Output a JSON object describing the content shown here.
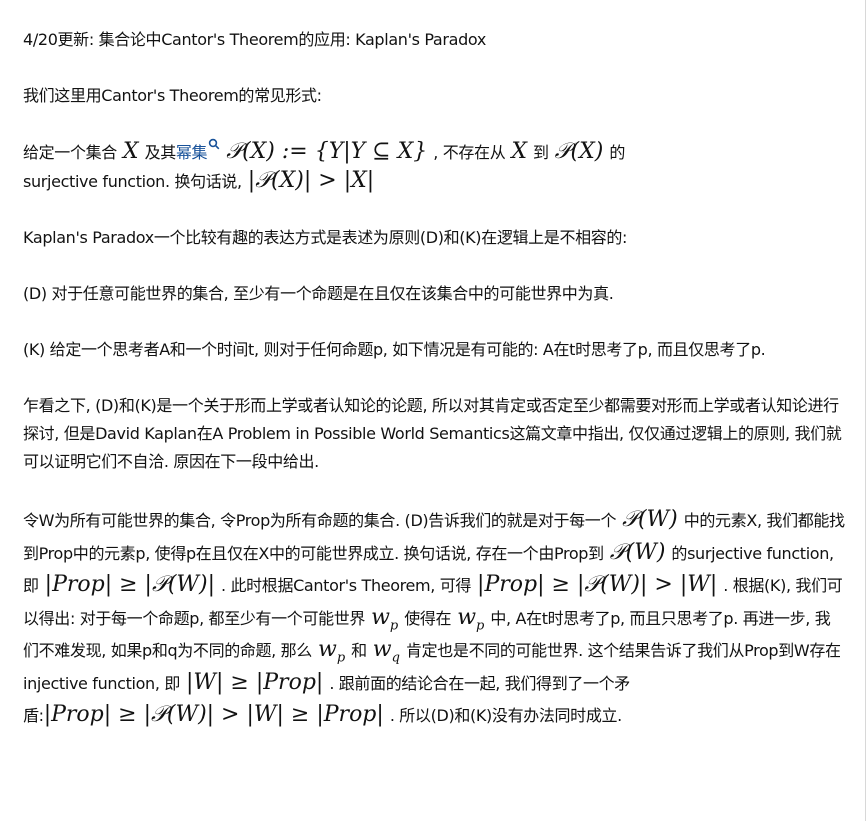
{
  "update_line": "4/20更新: 集合论中Cantor's Theorem的应用: Kaplan's Paradox",
  "intro": "我们这里用Cantor's Theorem的常见形式:",
  "theorem": {
    "t1": "给定一个集合",
    "m_X": "X",
    "t2": "及其",
    "link": "幂集",
    "m_powerset": "𝒫(X) := {Y|Y ⊆ X}",
    "t3": ", 不存在从",
    "m_X2": "X",
    "t4": "到",
    "m_PX": "𝒫(X)",
    "t5": "的",
    "t6": "surjective function. 换句话说,",
    "m_card": "|𝒫(X)| > |X|"
  },
  "p_kaplan": "Kaplan's Paradox一个比较有趣的表达方式是表述为原则(D)和(K)在逻辑上是不相容的:",
  "p_D": "(D) 对于任意可能世界的集合, 至少有一个命题是在且仅在该集合中的可能世界中为真.",
  "p_K": "(K) 给定一个思考者A和一个时间t, 则对于任何命题p, 如下情况是有可能的: A在t时思考了p, 而且仅思考了p.",
  "p_glance": "乍看之下, (D)和(K)是一个关于形而上学或者认知论的论题, 所以对其肯定或否定至少都需要对形而上学或者认知论进行探讨, 但是David Kaplan在A Problem in Possible World Semantics这篇文章中指出, 仅仅通过逻辑上的原则, 我们就可以证明它们不自洽. 原因在下一段中给出.",
  "proof": {
    "s1": "令W为所有可能世界的集合, 令Prop为所有命题的集合. (D)告诉我们的就是对于每一个",
    "m1": "𝒫(W)",
    "s2": "中的元素X, 我们都能找到Prop中的元素p, 使得p在且仅在X中的可能世界成立. 换句话说, 存在一个由Prop到",
    "m2": "𝒫(W)",
    "s3": "的surjective function, 即",
    "m3": "|Prop| ≥ |𝒫(W)|",
    "s4": ". 此时根据Cantor's Theorem, 可得",
    "m4": "|Prop| ≥ |𝒫(W)| > |W|",
    "s5": ". 根据(K), 我们可以得出: 对于每一个命题p, 都至少有一个可能世界",
    "m5_base": "w",
    "m5_sub": "p",
    "s6": "使得在",
    "m6_base": "w",
    "m6_sub": "p",
    "s7": "中, A在t时思考了p, 而且只思考了p. 再进一步, 我们不难发现, 如果p和q为不同的命题, 那么",
    "m7_base": "w",
    "m7_sub": "p",
    "s8": "和",
    "m8_base": "w",
    "m8_sub": "q",
    "s9": "肯定也是不同的可能世界. 这个结果告诉了我们从Prop到W存在injective function, 即",
    "m9": "|W| ≥ |Prop|",
    "s10": ". 跟前面的结论合在一起, 我们得到了一个矛盾:",
    "m10": "|Prop| ≥ |𝒫(W)| > |W| ≥ |Prop|",
    "s11": ". 所以(D)和(K)没有办法同时成立."
  }
}
